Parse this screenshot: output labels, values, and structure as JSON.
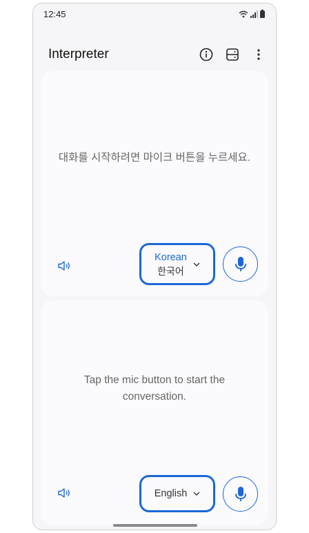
{
  "status": {
    "time": "12:45"
  },
  "app": {
    "title": "Interpreter"
  },
  "top_panel": {
    "prompt": "대화를 시작하려면 마이크 버튼을 누르세요.",
    "language_primary": "Korean",
    "language_secondary": "한국어"
  },
  "bottom_panel": {
    "prompt": "Tap the mic button to start the conversation.",
    "language_primary": "English"
  },
  "colors": {
    "accent": "#1a67d7",
    "panel_bg": "#fbfafd",
    "screen_bg": "#f6f5f8"
  }
}
